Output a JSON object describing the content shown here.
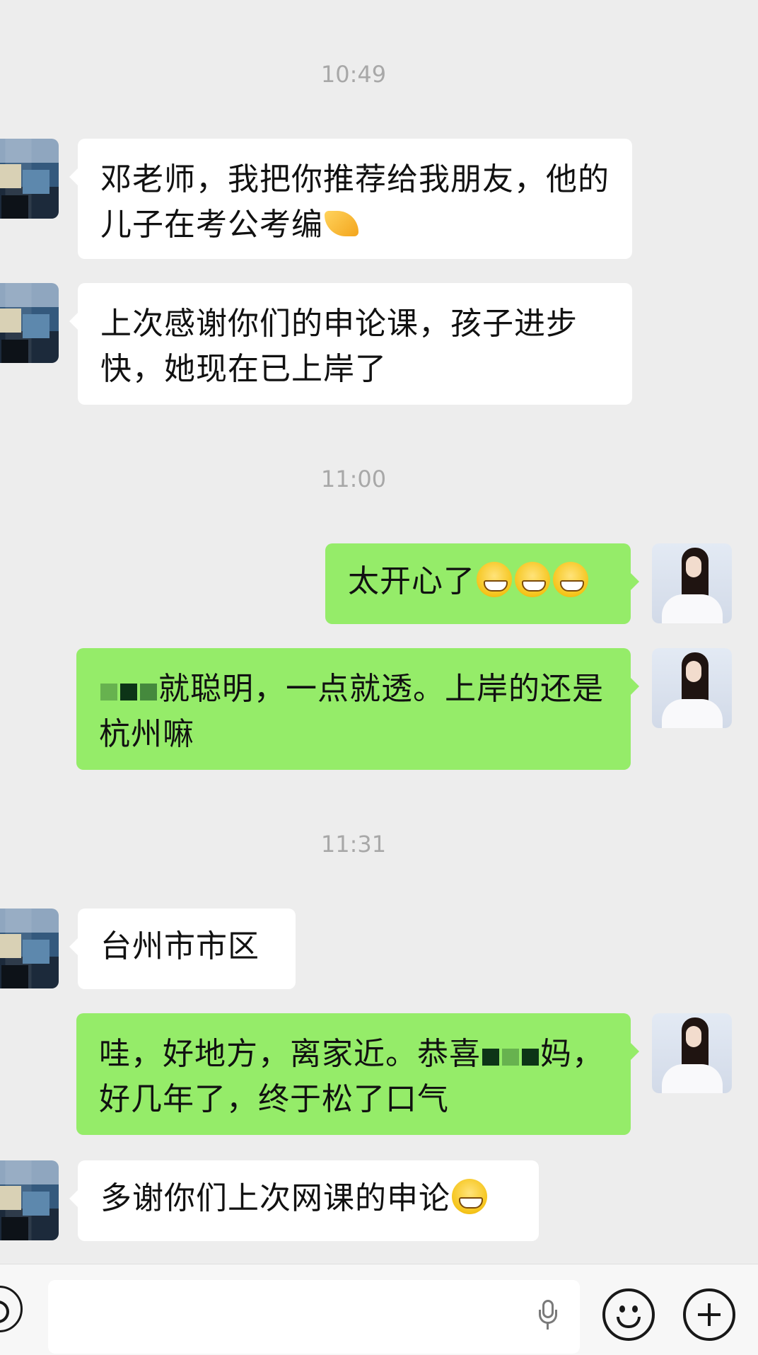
{
  "timestamps": [
    "10:49",
    "11:00",
    "11:31"
  ],
  "messages": [
    {
      "side": "incoming",
      "text": "邓老师，我把你推荐给我朋友，他的儿子在考公考编",
      "emoji": "pinched-hand"
    },
    {
      "side": "incoming",
      "text": "上次感谢你们的申论课，孩子进步快，她现在已上岸了"
    },
    {
      "side": "outgoing",
      "text": "太开心了",
      "emoji": "grinning-face-x3"
    },
    {
      "side": "outgoing",
      "text_after_redaction": "就聪明，一点就透。上岸的还是杭州嘛"
    },
    {
      "side": "incoming",
      "text": "台州市市区"
    },
    {
      "side": "outgoing",
      "text_before_redaction": "哇，好地方，离家近。恭喜",
      "text_after_redaction": "妈，好几年了，终于松了口气"
    },
    {
      "side": "incoming",
      "text": "多谢你们上次网课的申论",
      "emoji": "grinning-face"
    }
  ],
  "colors": {
    "background": "#ededed",
    "incoming_bubble": "#ffffff",
    "outgoing_bubble": "#95ec69",
    "timestamp_text": "#a8a8a8"
  },
  "toolbar": {
    "voice_icon": "voice-input-icon",
    "mic_icon": "microphone-icon",
    "emoji_icon": "emoji-icon",
    "plus_icon": "plus-icon"
  }
}
